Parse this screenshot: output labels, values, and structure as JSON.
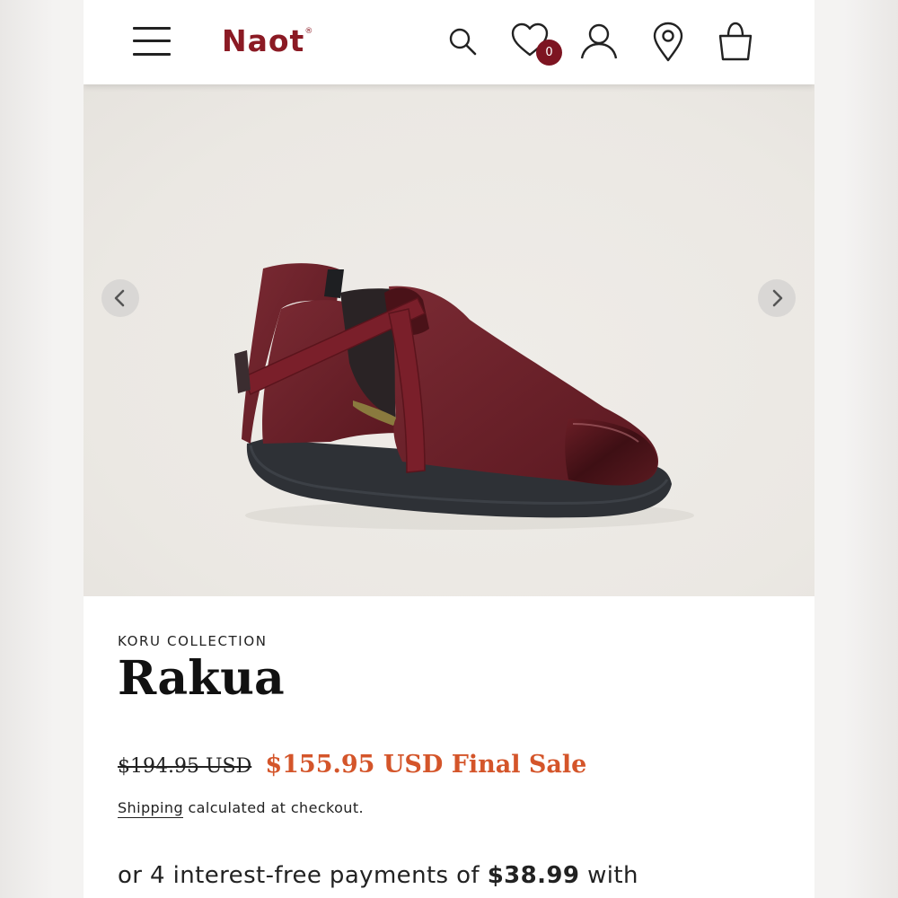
{
  "header": {
    "logo": "Naot",
    "logo_mark": "®",
    "wishlist_count": "0"
  },
  "gallery": {
    "prev_label": "Previous image",
    "next_label": "Next image"
  },
  "product": {
    "collection": "KORU COLLECTION",
    "name": "Rakua",
    "original_price": "$194.95 USD",
    "sale_price": "$155.95 USD Final Sale",
    "shipping_link": "Shipping",
    "shipping_text": " calculated at checkout.",
    "installment_prefix": "or 4 interest-free payments of ",
    "installment_amount": "$38.99",
    "installment_suffix": " with"
  },
  "colors": {
    "brand": "#8b1a24",
    "sale": "#d4552a",
    "badge": "#7d1421"
  },
  "icons": [
    "menu-icon",
    "search-icon",
    "heart-icon",
    "account-icon",
    "location-pin-icon",
    "shopping-bag-icon",
    "chevron-left-icon",
    "chevron-right-icon"
  ]
}
